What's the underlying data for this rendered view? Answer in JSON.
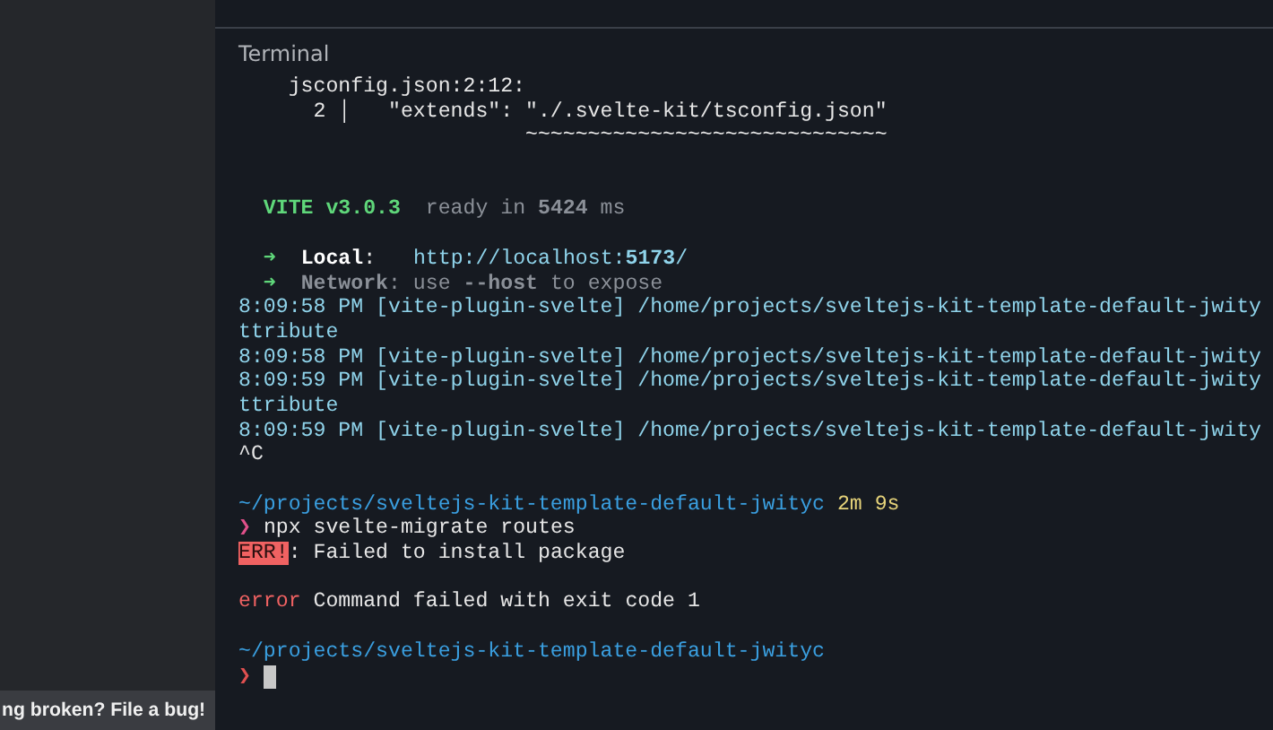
{
  "sidebar": {
    "bug_link": "ng broken? File a bug!"
  },
  "terminal": {
    "title": "Terminal",
    "sections": [
      {
        "kind": "error-log",
        "lines": [
          [
            {
              "text": "    jsconfig.json:2:12:",
              "kind": "plain"
            }
          ],
          [
            {
              "text": "      2 │   \"extends\": \"./.svelte-kit/tsconfig.json\"",
              "kind": "plain"
            }
          ],
          [
            {
              "text": "                       ~~~~~~~~~~~~~~~~~~~~~~~~~~~~~",
              "kind": "plain"
            }
          ]
        ]
      },
      {
        "kind": "banner",
        "lines": [
          [
            {
              "text": "  VITE v3.0.3",
              "kind": "green-bold"
            },
            {
              "text": "  ready in ",
              "kind": "dim"
            },
            {
              "text": "5424",
              "kind": "dim-bold"
            },
            {
              "text": " ms",
              "kind": "dim"
            }
          ]
        ]
      },
      {
        "kind": "output",
        "lines": [
          [
            {
              "text": "  ➜  ",
              "kind": "green"
            },
            {
              "text": "Local",
              "kind": "bold"
            },
            {
              "text": ":   ",
              "kind": "plain"
            },
            {
              "text": "http://localhost:",
              "kind": "cyan"
            },
            {
              "text": "5173",
              "kind": "cyan-bold"
            },
            {
              "text": "/",
              "kind": "cyan"
            }
          ],
          [
            {
              "text": "  ➜  ",
              "kind": "green"
            },
            {
              "text": "Network",
              "kind": "dim-bold"
            },
            {
              "text": ": use ",
              "kind": "dim"
            },
            {
              "text": "--host",
              "kind": "dim-bold"
            },
            {
              "text": " to expose",
              "kind": "dim"
            }
          ],
          [
            {
              "text": "8:09:58 PM [vite-plugin-svelte] /home/projects/sveltejs-kit-template-default-jwity",
              "kind": "cyan"
            }
          ],
          [
            {
              "text": "ttribute",
              "kind": "cyan"
            }
          ],
          [
            {
              "text": "8:09:58 PM [vite-plugin-svelte] /home/projects/sveltejs-kit-template-default-jwity",
              "kind": "cyan"
            }
          ],
          [
            {
              "text": "8:09:59 PM [vite-plugin-svelte] /home/projects/sveltejs-kit-template-default-jwity",
              "kind": "cyan"
            }
          ],
          [
            {
              "text": "ttribute",
              "kind": "cyan"
            }
          ],
          [
            {
              "text": "8:09:59 PM [vite-plugin-svelte] /home/projects/sveltejs-kit-template-default-jwity",
              "kind": "cyan"
            }
          ],
          [
            {
              "text": "^C",
              "kind": "plain"
            }
          ]
        ]
      },
      {
        "kind": "output",
        "lines": [
          [
            {
              "text": "~/projects/sveltejs-kit-template-default-jwityc",
              "kind": "path"
            },
            {
              "text": " 2m 9s",
              "kind": "duration"
            }
          ],
          [
            {
              "text": "❯",
              "kind": "prompt"
            },
            {
              "text": " npx svelte-migrate routes",
              "kind": "plain"
            }
          ],
          [
            {
              "text": "ERR!",
              "kind": "err-badge"
            },
            {
              "text": ": Failed to install package",
              "kind": "plain"
            }
          ]
        ]
      },
      {
        "kind": "output",
        "lines": [
          [
            {
              "text": "error",
              "kind": "error"
            },
            {
              "text": " Command failed with exit code 1",
              "kind": "plain"
            }
          ]
        ]
      },
      {
        "kind": "output",
        "lines": [
          [
            {
              "text": "~/projects/sveltejs-kit-template-default-jwityc",
              "kind": "path"
            }
          ],
          [
            {
              "text": "❯",
              "kind": "prompt-error"
            }
          ]
        ]
      }
    ],
    "cursor": true
  }
}
